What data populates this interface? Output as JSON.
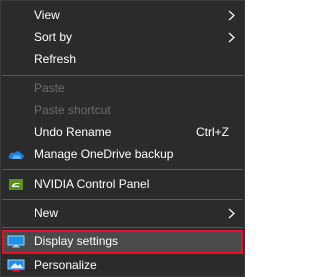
{
  "menu": {
    "items": [
      {
        "label": "View",
        "submenu": true
      },
      {
        "label": "Sort by",
        "submenu": true
      },
      {
        "label": "Refresh"
      },
      {
        "label": "Paste",
        "disabled": true
      },
      {
        "label": "Paste shortcut",
        "disabled": true
      },
      {
        "label": "Undo Rename",
        "shortcut": "Ctrl+Z"
      },
      {
        "label": "Manage OneDrive backup",
        "icon": "onedrive-icon"
      },
      {
        "label": "NVIDIA Control Panel",
        "icon": "nvidia-icon"
      },
      {
        "label": "New",
        "submenu": true
      },
      {
        "label": "Display settings",
        "icon": "display-settings-icon",
        "highlighted": true
      },
      {
        "label": "Personalize",
        "icon": "personalize-icon"
      }
    ]
  },
  "colors": {
    "menu_background": "#2b2b2b",
    "text": "#ffffff",
    "disabled_text": "#6d6d6d",
    "highlight_background": "#4a4a4a",
    "highlight_border": "#e81123",
    "separator": "#5a5a5a"
  }
}
